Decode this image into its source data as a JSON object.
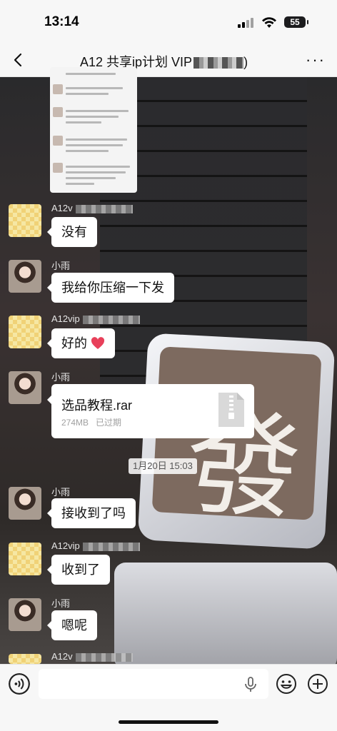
{
  "status_bar": {
    "time": "13:14",
    "battery": "55"
  },
  "nav": {
    "title": "A12 共享ip计划 VIP",
    "title_suffix": ")"
  },
  "messages": [
    {
      "sender": "A12v",
      "text": "没有"
    },
    {
      "sender": "小雨",
      "text": "我给你压缩一下发"
    },
    {
      "sender": "A12vip",
      "text": "好的"
    },
    {
      "sender": "小雨",
      "file": {
        "name": "选品教程.rar",
        "size": "274MB",
        "status": "已过期"
      }
    },
    {
      "sender": "小雨",
      "text": "接收到了吗"
    },
    {
      "sender": "A12vip",
      "text": "收到了"
    },
    {
      "sender": "小雨",
      "text": "嗯呢"
    },
    {
      "sender": "A12v"
    }
  ],
  "divider": {
    "time": "1月20日 15:03"
  },
  "input": {
    "placeholder": ""
  },
  "colors": {
    "bubble": "#ffffff",
    "nav_bg": "#f7f7f7",
    "heart": "#e8405a"
  }
}
